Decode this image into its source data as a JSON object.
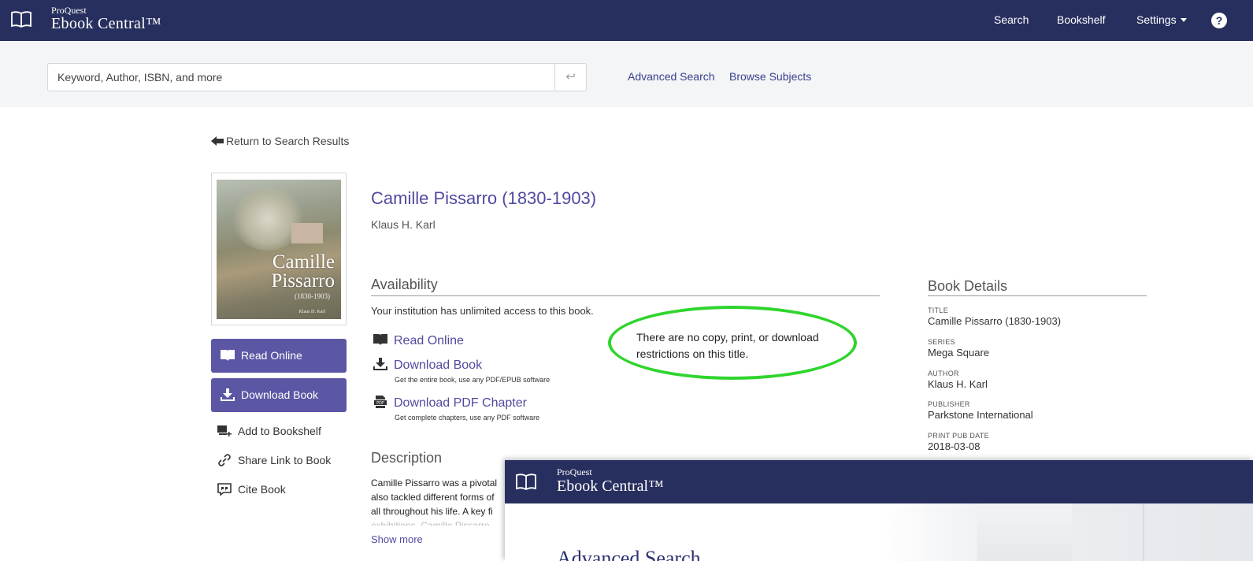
{
  "navbar": {
    "brand_small": "ProQuest",
    "brand_big": "Ebook Central™",
    "links": {
      "search": "Search",
      "bookshelf": "Bookshelf",
      "settings": "Settings"
    },
    "help_glyph": "?"
  },
  "search": {
    "placeholder": "Keyword, Author, ISBN, and more",
    "submit_glyph": "↩",
    "advanced": "Advanced Search",
    "browse": "Browse Subjects"
  },
  "return_link": "Return to Search Results",
  "cover": {
    "title_line1": "Camille",
    "title_line2": "Pissarro",
    "years": "(1830-1903)",
    "author": "Klaus H. Karl"
  },
  "sidebar": {
    "read_online": "Read Online",
    "download_book": "Download Book",
    "add_to_bookshelf": "Add to Bookshelf",
    "share_link": "Share Link to Book",
    "cite_book": "Cite Book"
  },
  "book": {
    "title": "Camille Pissarro (1830-1903)",
    "author": "Klaus H. Karl"
  },
  "availability": {
    "heading": "Availability",
    "access_text": "Your institution has unlimited access to this book.",
    "read_online": "Read Online",
    "download_book": "Download Book",
    "download_book_sub": "Get the entire book, use any PDF/EPUB software",
    "download_pdf": "Download PDF Chapter",
    "download_pdf_sub": "Get complete chapters, use any PDF software"
  },
  "callout": "There are no copy, print, or download restrictions on this title.",
  "description": {
    "heading": "Description",
    "lines": [
      "Camille Pissarro was a pivotal",
      "also tackled different forms of",
      "all throughout his life. A key fi",
      "exhibitions, Camille Pissarro"
    ],
    "show_more": "Show more"
  },
  "details": {
    "heading": "Book Details",
    "title_label": "TITLE",
    "title_value": "Camille Pissarro (1830-1903)",
    "series_label": "SERIES",
    "series_value": "Mega Square",
    "author_label": "AUTHOR",
    "author_value": "Klaus H. Karl",
    "publisher_label": "PUBLISHER",
    "publisher_value": "Parkstone International",
    "date_label": "PRINT PUB DATE",
    "date_value": "2018-03-08"
  },
  "overlay": {
    "brand_small": "ProQuest",
    "brand_big": "Ebook Central™",
    "page_title": "Advanced Search"
  },
  "colors": {
    "navbar": "#272f5e",
    "accent": "#5b57a5",
    "link": "#4f4aa0",
    "callout": "#2fd52d"
  },
  "icons": [
    "book-open-icon",
    "help-icon",
    "return-icon",
    "read-icon",
    "download-icon",
    "pdf-icon",
    "add-bookshelf-icon",
    "link-icon",
    "cite-icon"
  ]
}
